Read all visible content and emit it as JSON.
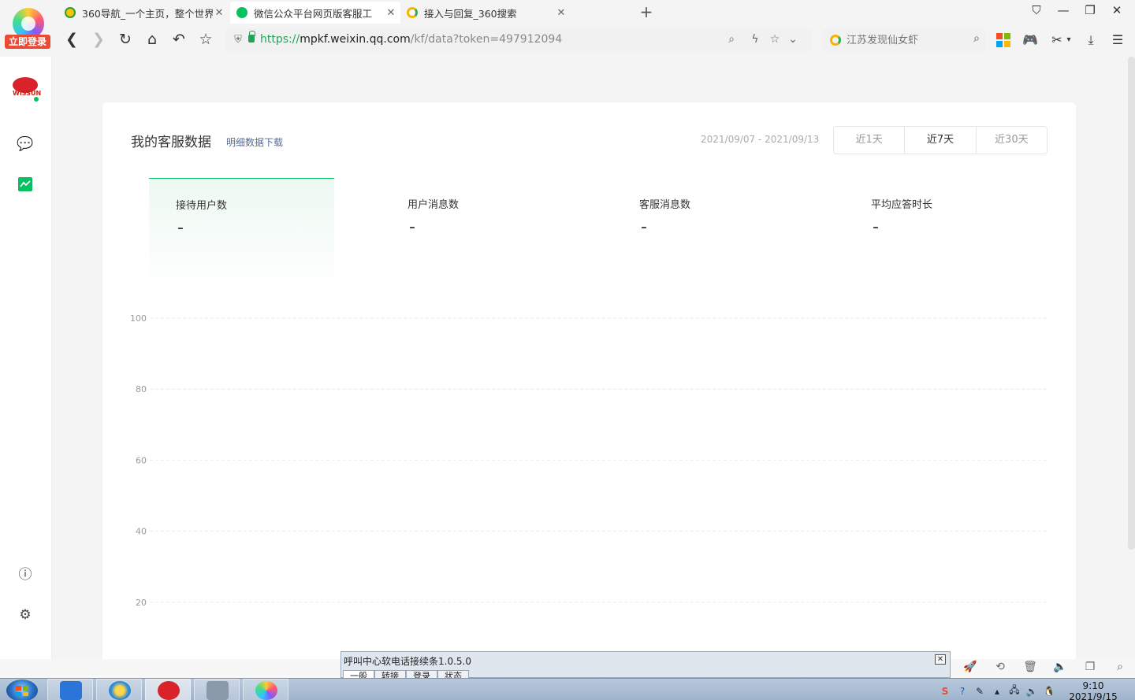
{
  "browser": {
    "login_label": "立即登录",
    "tabs": [
      {
        "title": "360导航_一个主页，整个世界",
        "active": false
      },
      {
        "title": "微信公众平台网页版客服工",
        "active": true
      },
      {
        "title": "接入与回复_360搜索",
        "active": false
      }
    ],
    "url": {
      "scheme": "https://",
      "host": "mpkf.weixin.qq.com",
      "path": "/kf/data?token=497912094"
    },
    "search_placeholder": "江苏发现仙女虾",
    "accent": "#20a45a"
  },
  "sidebar": {
    "avatar_text": "WISSUN",
    "items": [
      {
        "icon": "chat-bubble-icon"
      },
      {
        "icon": "data-chart-icon",
        "active": true
      },
      {
        "icon": "help-icon"
      },
      {
        "icon": "settings-gear-icon"
      }
    ],
    "accent": "#07c160"
  },
  "main": {
    "title": "我的客服数据",
    "download_link": "明细数据下载",
    "date_range": "2021/09/07 - 2021/09/13",
    "range_buttons": [
      "近1天",
      "近7天",
      "近30天"
    ],
    "active_range": "近7天",
    "stats": [
      {
        "label": "接待用户数",
        "value": "-",
        "active": true
      },
      {
        "label": "用户消息数",
        "value": "-"
      },
      {
        "label": "客服消息数",
        "value": "-"
      },
      {
        "label": "平均应答时长",
        "value": "-"
      }
    ]
  },
  "chart_data": {
    "type": "line",
    "ylim": [
      0,
      100
    ],
    "y_ticks": [
      100,
      80,
      60,
      40,
      20
    ],
    "series": [],
    "grid": true
  },
  "popup": {
    "title": "呼叫中心软电话接续条1.0.5.0",
    "close_label": "✕",
    "tabs": [
      "一般",
      "转接",
      "登录",
      "状态"
    ]
  },
  "taskbar": {
    "time": "9:10",
    "date": "2021/9/15"
  }
}
